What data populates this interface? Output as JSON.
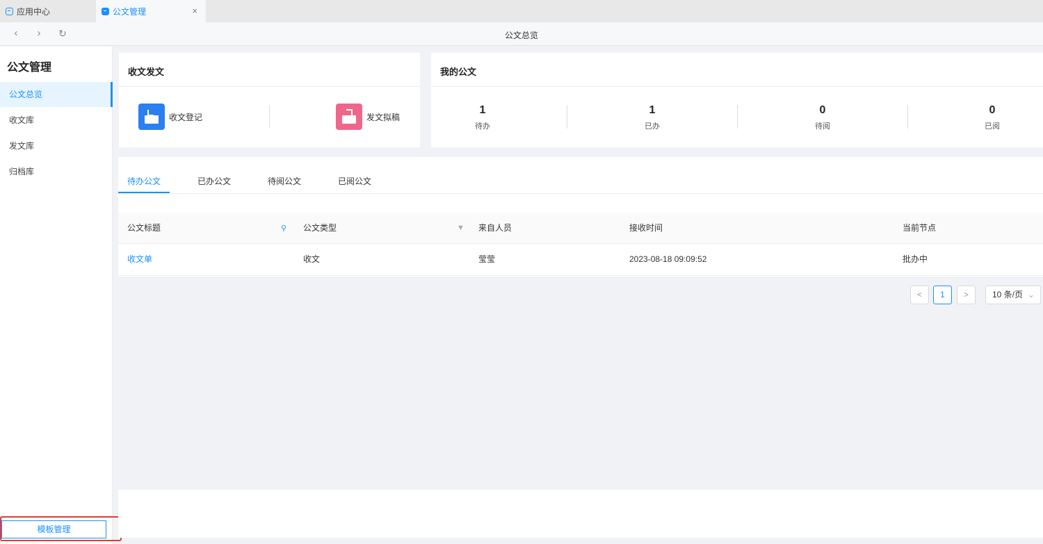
{
  "window_tabs": [
    {
      "label": "应用中心"
    },
    {
      "label": "公文管理",
      "close": "×"
    }
  ],
  "nav": {
    "back": "‹",
    "forward": "›",
    "refresh": "↻",
    "title": "公文总览"
  },
  "sidebar": {
    "title": "公文管理",
    "items": [
      {
        "label": "公文总览",
        "active": true
      },
      {
        "label": "收文库"
      },
      {
        "label": "发文库"
      },
      {
        "label": "归档库"
      }
    ],
    "bottom_button": "模板管理"
  },
  "send_receive": {
    "title": "收文发文",
    "actions": [
      {
        "label": "收文登记",
        "icon": "inbox-download-icon",
        "color": "#2b7ff0"
      },
      {
        "label": "发文拟稿",
        "icon": "outbox-upload-icon",
        "color": "#f0668a"
      }
    ]
  },
  "my_docs": {
    "title": "我的公文",
    "stats": [
      {
        "value": "1",
        "label": "待办"
      },
      {
        "value": "1",
        "label": "已办"
      },
      {
        "value": "0",
        "label": "待阅"
      },
      {
        "value": "0",
        "label": "已阅"
      }
    ]
  },
  "doc_tabs": [
    {
      "label": "待办公文",
      "active": true
    },
    {
      "label": "已办公文"
    },
    {
      "label": "待阅公文"
    },
    {
      "label": "已阅公文"
    }
  ],
  "table": {
    "columns": [
      "公文标题",
      "公文类型",
      "来自人员",
      "接收时间",
      "当前节点"
    ],
    "rows": [
      [
        "收文单",
        "收文",
        "莹莹",
        "2023-08-18 09:09:52",
        "批办中"
      ]
    ]
  },
  "pagination": {
    "prev": "<",
    "current": "1",
    "next": ">",
    "page_size": "10 条/页"
  },
  "colors": {
    "accent": "#1890ff",
    "highlight": "#e53935"
  }
}
